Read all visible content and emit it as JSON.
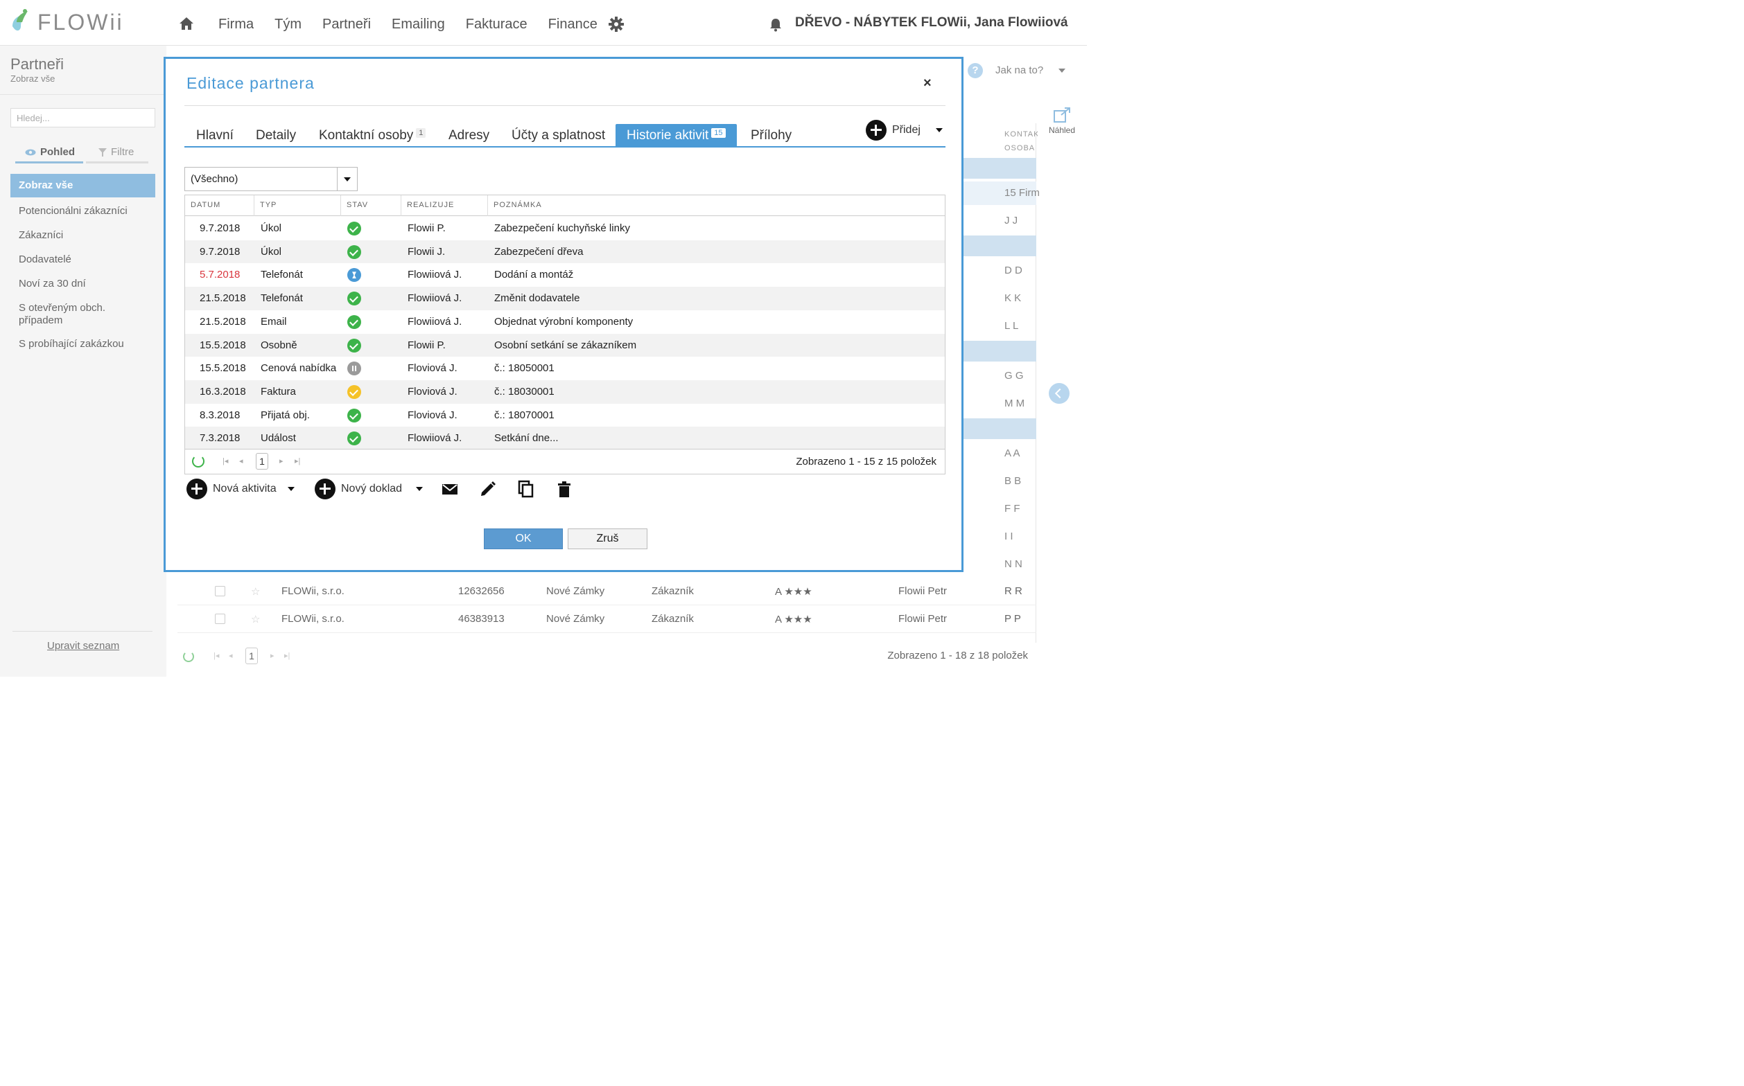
{
  "app": {
    "logo_text": "FLOWii",
    "nav": [
      "Firma",
      "Tým",
      "Partneři",
      "Emailing",
      "Fakturace",
      "Finance"
    ],
    "company_user": "DŘEVO - NÁBYTEK FLOWii, Jana Flowiiová"
  },
  "sidebar": {
    "title": "Partneři",
    "subtitle": "Zobraz vše",
    "search_placeholder": "Hledej...",
    "view_tab": "Pohled",
    "filter_tab": "Filtre",
    "active_item": "Zobraz vše",
    "items": [
      "Potencionálni zákazníci",
      "Zákazníci",
      "Dodavatelé",
      "Noví za 30 dní",
      "S otevřeným obch. případem",
      "S probíhající zakázkou"
    ],
    "edit_list": "Upravit seznam"
  },
  "background": {
    "help": "Jak na to?",
    "preview": "Náhled",
    "col_header": "KONTAKT OSOBA",
    "first_value": "15 Firm",
    "initials": [
      "J J",
      "D D",
      "K K",
      "L L",
      "G G",
      "M M",
      "A A",
      "B B",
      "F F",
      "I I",
      "N N",
      "R R",
      "P P"
    ],
    "rows": [
      {
        "name": "FLOWii, s.r.o.",
        "ico": "12632656",
        "city": "Nové Zámky",
        "type": "Zákazník",
        "rating": "A ★★★",
        "owner": "Flowii Petr"
      },
      {
        "name": "FLOWii, s.r.o.",
        "ico": "46383913",
        "city": "Nové Zámky",
        "type": "Zákazník",
        "rating": "A ★★★",
        "owner": "Flowii Petr"
      }
    ],
    "pager_page": "1",
    "pager_info": "Zobrazeno 1 - 18 z 18 položek"
  },
  "modal": {
    "title": "Editace partnera",
    "close": "×",
    "tabs": [
      {
        "label": "Hlavní"
      },
      {
        "label": "Detaily"
      },
      {
        "label": "Kontaktní osoby",
        "badge": "1"
      },
      {
        "label": "Adresy"
      },
      {
        "label": "Účty a splatnost"
      },
      {
        "label": "Historie aktivit",
        "badge": "15"
      },
      {
        "label": "Přílohy"
      }
    ],
    "add_label": "Přidej",
    "filter_value": "(Všechno)",
    "columns": [
      "DATUM",
      "TYP",
      "STAV",
      "REALIZUJE",
      "POZNÁMKA"
    ],
    "rows": [
      {
        "date": "9.7.2018",
        "type": "Úkol",
        "status": "done",
        "who": "Flowii P.",
        "note": "Zabezpečení kuchyňské linky"
      },
      {
        "date": "9.7.2018",
        "type": "Úkol",
        "status": "done",
        "who": "Flowii J.",
        "note": "Zabezpečení dřeva"
      },
      {
        "date": "5.7.2018",
        "type": "Telefonát",
        "status": "wait",
        "who": "Flowiiová J.",
        "note": "Dodání a montáž",
        "overdue": true
      },
      {
        "date": "21.5.2018",
        "type": "Telefonát",
        "status": "done",
        "who": "Flowiiová J.",
        "note": "Změnit dodavatele"
      },
      {
        "date": "21.5.2018",
        "type": "Email",
        "status": "done",
        "who": "Flowiiová J.",
        "note": "Objednat výrobní komponenty"
      },
      {
        "date": "15.5.2018",
        "type": "Osobně",
        "status": "done",
        "who": "Flowii P.",
        "note": "Osobní setkání se zákazníkem"
      },
      {
        "date": "15.5.2018",
        "type": "Cenová nabídka",
        "status": "paused",
        "who": "Floviová J.",
        "note": "č.: 18050001"
      },
      {
        "date": "16.3.2018",
        "type": "Faktura",
        "status": "pending",
        "who": "Floviová J.",
        "note": "č.: 18030001"
      },
      {
        "date": "8.3.2018",
        "type": "Přijatá obj.",
        "status": "done",
        "who": "Floviová J.",
        "note": "č.: 18070001"
      },
      {
        "date": "7.3.2018",
        "type": "Událost",
        "status": "done",
        "who": "Flowiiová J.",
        "note": "Setkání dne..."
      }
    ],
    "pager_page": "1",
    "pager_info": "Zobrazeno 1 - 15 z 15 položek",
    "new_activity": "Nová aktivita",
    "new_document": "Nový doklad",
    "ok": "OK",
    "cancel": "Zruš"
  },
  "colors": {
    "accent": "#4a9ad6",
    "done": "#3db34a",
    "pending": "#f5c228",
    "overdue": "#d9363e"
  }
}
